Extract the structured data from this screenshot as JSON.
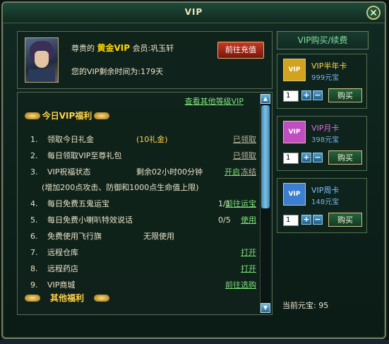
{
  "window": {
    "title": "VIP",
    "close_label": "✕"
  },
  "profile": {
    "prefix": "尊贵的",
    "level": "黄金VIP",
    "member_prefix": "会员:",
    "member_name": "巩玉轩",
    "remaining_label": "您的VIP剩余时间为:",
    "remaining_value": "179天",
    "recharge_label": "前往充值"
  },
  "benefits": {
    "other_levels_link": "查看其他等级VIP",
    "today_header": "今日VIP福利",
    "other_header": "其他福利",
    "items": [
      {
        "num": "1.",
        "text": "领取今日礼金",
        "extra": "(10礼金)",
        "status": "已领取"
      },
      {
        "num": "2.",
        "text": "每日领取VIP至尊礼包",
        "extra": "",
        "status": "已领取"
      },
      {
        "num": "3.",
        "text": "VIP祝福状态",
        "extra": "剩余02小时00分钟",
        "action": "开启",
        "status": "冻结"
      },
      {
        "num": "",
        "text": "(增加200点攻击、防御和1000点生命值上限)",
        "extra": "",
        "status": ""
      },
      {
        "num": "4.",
        "text": "每日免费五鬼运宝",
        "extra": "1/1",
        "status": "前往运宝"
      },
      {
        "num": "5.",
        "text": "每日免费小喇叭特效说话",
        "extra": "0/5",
        "status": "使用"
      },
      {
        "num": "6.",
        "text": "免费使用飞行旗",
        "extra": "无限使用",
        "status": ""
      },
      {
        "num": "7.",
        "text": "远程仓库",
        "extra": "",
        "status": "打开"
      },
      {
        "num": "8.",
        "text": "远程药店",
        "extra": "",
        "status": "打开"
      },
      {
        "num": "9.",
        "text": "VIP商城",
        "extra": "",
        "status": "前往选购"
      }
    ]
  },
  "shop": {
    "header": "VIP购买/续费",
    "cards": [
      {
        "name": "VIP半年卡",
        "price": "999元宝",
        "qty": "1",
        "buy": "购买",
        "badge": "VIP",
        "name_color": "#ffd24a",
        "icon_bg": "#d2a41e"
      },
      {
        "name": "VIP月卡",
        "price": "398元宝",
        "qty": "1",
        "buy": "购买",
        "badge": "VIP",
        "name_color": "#e070e0",
        "icon_bg": "#c04ec0"
      },
      {
        "name": "VIP周卡",
        "price": "148元宝",
        "qty": "1",
        "buy": "购买",
        "badge": "VIP",
        "name_color": "#7fc0ff",
        "icon_bg": "#3c7fd0"
      }
    ],
    "plus": "+",
    "minus": "−"
  },
  "balance": {
    "label": "当前元宝:",
    "value": "95"
  }
}
